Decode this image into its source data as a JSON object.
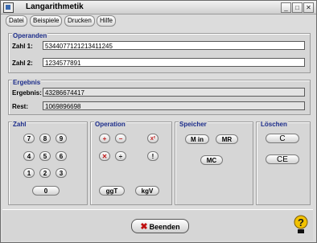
{
  "window": {
    "title": "Langarithmetik",
    "controls": [
      "_",
      "□",
      "✕"
    ]
  },
  "menu": [
    {
      "label": "Datei"
    },
    {
      "label": "Beispiele"
    },
    {
      "label": "Drucken"
    },
    {
      "label": "Hilfe"
    }
  ],
  "operanden": {
    "title": "Operanden",
    "zahl1_label": "Zahl 1:",
    "zahl1_value": "5344077121213411245",
    "zahl2_label": "Zahl 2:",
    "zahl2_value": "1234577891"
  },
  "ergebnis": {
    "title": "Ergebnis",
    "ergebnis_label": "Ergebnis:",
    "ergebnis_value": "43286674417",
    "rest_label": "Rest:",
    "rest_value": "1069896698"
  },
  "zahl": {
    "title": "Zahl",
    "keys": [
      "7",
      "8",
      "9",
      "4",
      "5",
      "6",
      "1",
      "2",
      "3",
      "0"
    ]
  },
  "operation": {
    "title": "Operation",
    "plus": "+",
    "minus": "−",
    "power": "x²",
    "times": "✕",
    "divide": "÷",
    "factorial": "!",
    "ggt": "ggT",
    "kgv": "kgV"
  },
  "speicher": {
    "title": "Speicher",
    "min": "M in",
    "mr": "MR",
    "mc": "MC"
  },
  "loeschen": {
    "title": "Löschen",
    "c": "C",
    "ce": "CE"
  },
  "footer": {
    "beenden": "Beenden",
    "help_icon": "help-question-icon"
  },
  "colors": {
    "legend": "#1d2e8c",
    "operator": "#c01818",
    "help": "#f2c200"
  }
}
